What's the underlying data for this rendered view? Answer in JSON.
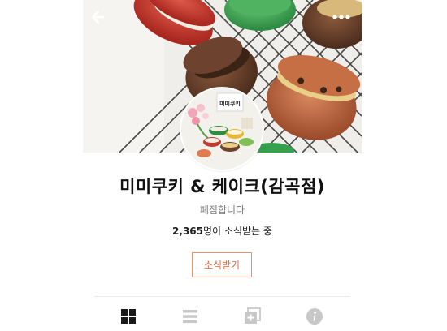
{
  "header": {
    "back_icon": "back-arrow-icon",
    "more_icon": "more-dots-icon"
  },
  "profile": {
    "name": "미미쿠키 & 케이크(감곡점)",
    "status": "폐점합니다",
    "subscriber_count": "2,365",
    "subscriber_suffix": "명이 소식받는 중",
    "subscribe_label": "소식받기",
    "avatar_text": "미미쿠키"
  },
  "tabs": [
    {
      "name": "grid",
      "icon": "grid-icon",
      "active": true
    },
    {
      "name": "list",
      "icon": "list-icon",
      "active": false
    },
    {
      "name": "add-post",
      "icon": "add-post-icon",
      "active": false
    },
    {
      "name": "info",
      "icon": "info-icon",
      "active": false
    }
  ],
  "colors": {
    "accent": "#e2693f",
    "text": "#111111",
    "muted": "#7a7a7a",
    "tab_inactive": "#c8c8c8",
    "tab_active": "#1a1a1a"
  }
}
